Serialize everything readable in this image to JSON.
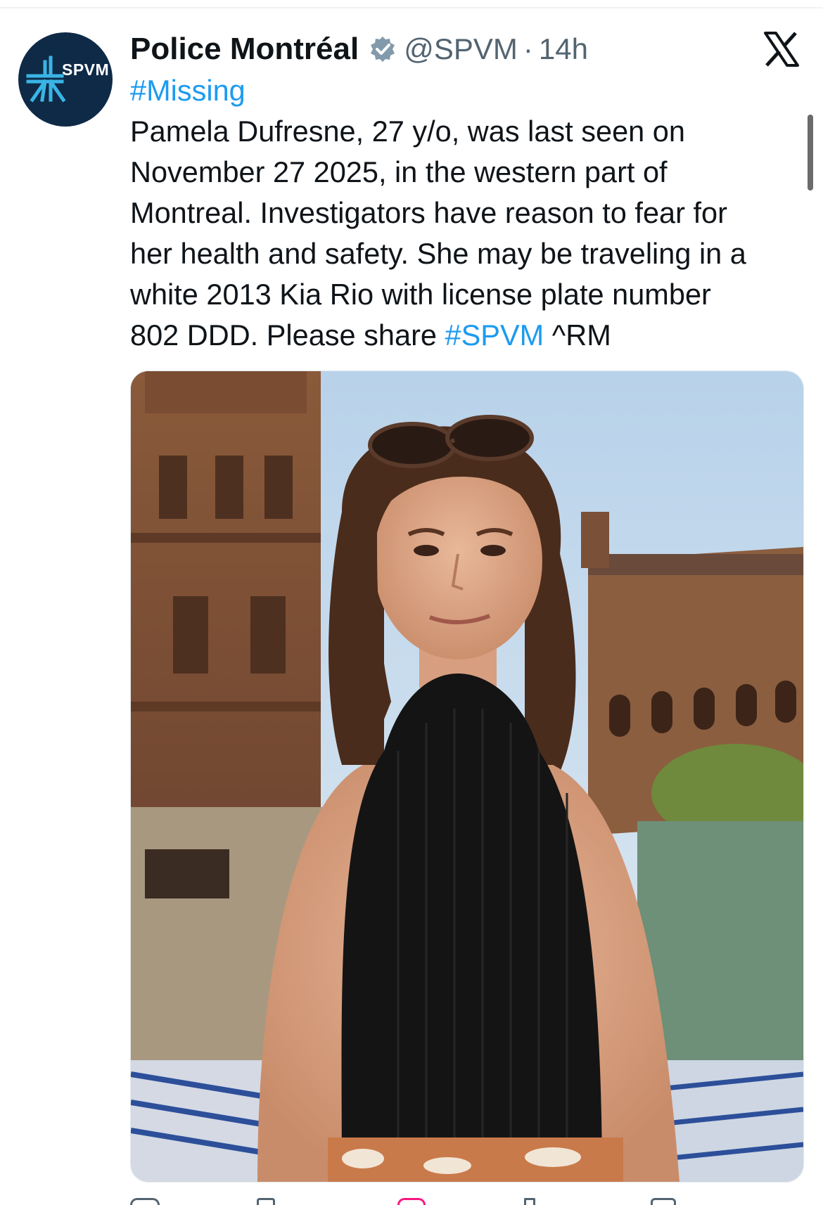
{
  "tweet": {
    "author": {
      "display_name": "Police Montréal",
      "handle": "@SPVM",
      "avatar_text": "SPVM",
      "verified_icon": "verified-badge-icon"
    },
    "separator": "·",
    "timestamp": "14h",
    "platform_icon": "x-logo-icon",
    "text_lines": [
      {
        "hashtag": "#Missing"
      },
      {
        "text": "Pamela Dufresne, 27 y/o, was last seen on"
      },
      {
        "text": "November 27 2025, in the western part of"
      },
      {
        "text": "Montreal. Investigators have reason to fear for"
      },
      {
        "text": "her health and safety. She may be traveling in a"
      },
      {
        "text": "white 2013 Kia Rio with license plate number"
      },
      {
        "before": "802 DDD. Please share ",
        "hashtag": "#SPVM",
        "after": " ^RM"
      }
    ],
    "media": {
      "type": "photo"
    }
  },
  "colors": {
    "text": "#0f1419",
    "secondary": "#536471",
    "link": "#1d9bf0",
    "avatar_bg": "#0e2a47",
    "avatar_accent": "#3ab4e6"
  }
}
